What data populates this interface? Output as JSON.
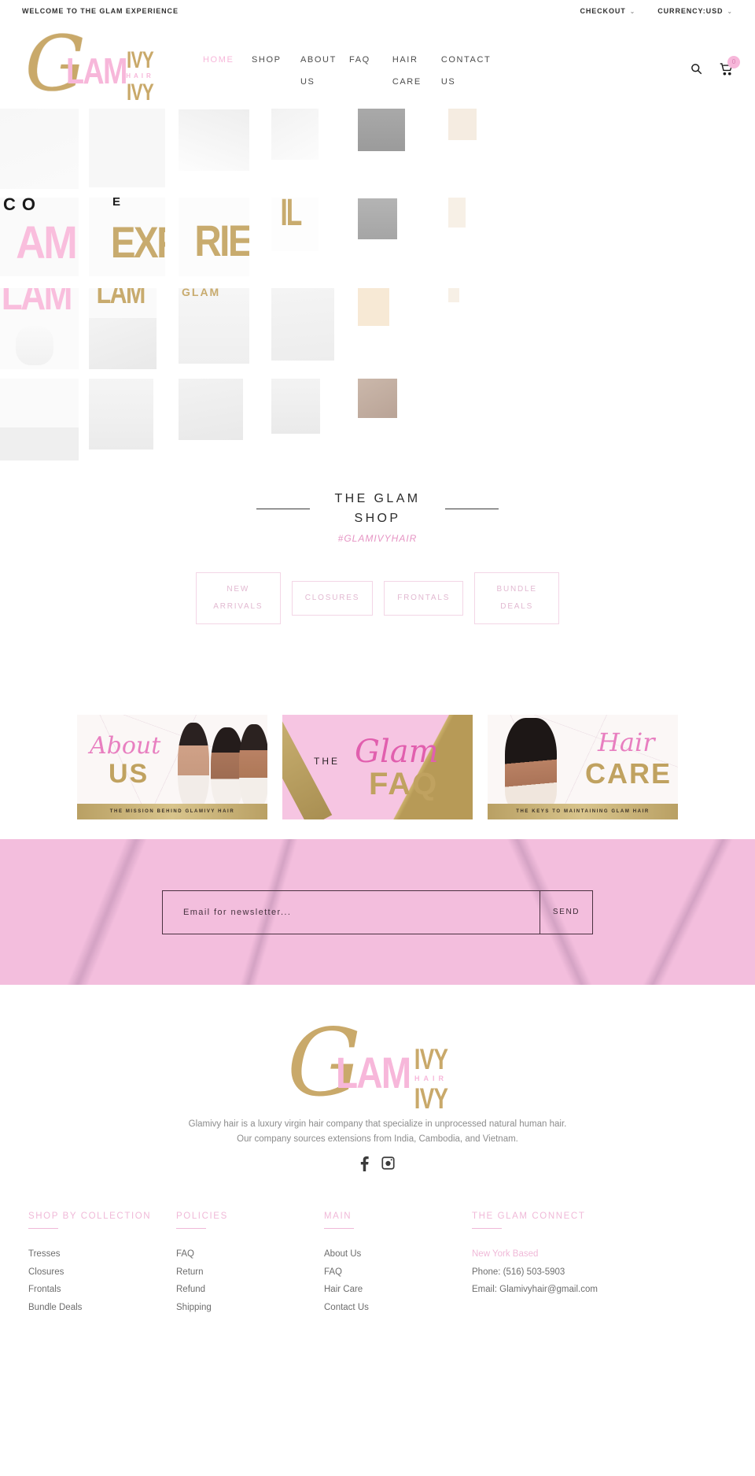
{
  "topbar": {
    "welcome": "WELCOME TO THE GLAM EXPERIENCE",
    "checkout": "CHECKOUT",
    "currency": "CURRENCY:USD",
    "caret": "⌄"
  },
  "logo": {
    "g": "G",
    "lam": "LAM",
    "ivy_top": "IVY",
    "ivy_hair": "HAIR",
    "ivy_bot": "IVY"
  },
  "nav": {
    "items": [
      {
        "label": "HOME",
        "active": true
      },
      {
        "label": "SHOP",
        "active": false
      },
      {
        "label": "ABOUT US",
        "active": false
      },
      {
        "label": "FAQ",
        "active": false
      },
      {
        "label": "HAIR CARE",
        "active": false
      },
      {
        "label": "CONTACT US",
        "active": false
      }
    ]
  },
  "header_icons": {
    "search": "search-icon",
    "cart": "cart-icon",
    "cart_count": "0"
  },
  "shop": {
    "title": "THE GLAM SHOP",
    "hashtag": "#GLAMIVYHAIR",
    "categories": [
      {
        "label": "NEW ARRIVALS"
      },
      {
        "label": "CLOSURES"
      },
      {
        "label": "FRONTALS"
      },
      {
        "label": "BUNDLE DEALS"
      }
    ]
  },
  "promos": [
    {
      "script": "About",
      "gold": "US",
      "caption": "THE MISSION BEHIND GLAMIVY HAIR"
    },
    {
      "the": "THE",
      "script": "Glam",
      "gold": "FAQ",
      "caption": ""
    },
    {
      "script": "Hair",
      "gold": "CARE",
      "caption": "THE KEYS TO MAINTAINING GLAM HAIR"
    }
  ],
  "newsletter": {
    "placeholder": "Email for newsletter...",
    "value": "",
    "send_label": "SEND"
  },
  "footer": {
    "description_line1": "Glamivy hair is a luxury virgin hair company that specialize in unprocessed natural human hair.",
    "description_line2": "Our company sources extensions from India, Cambodia, and Vietnam.",
    "socials": [
      {
        "name": "facebook-icon"
      },
      {
        "name": "instagram-icon"
      }
    ],
    "columns": [
      {
        "title": "SHOP BY COLLECTION",
        "links": [
          "Tresses",
          "Closures",
          "Frontals",
          "Bundle Deals"
        ]
      },
      {
        "title": "POLICIES",
        "links": [
          "FAQ",
          "Return",
          "Refund",
          "Shipping"
        ]
      },
      {
        "title": "MAIN",
        "links": [
          "About Us",
          "FAQ",
          "Hair Care",
          "Contact Us"
        ]
      },
      {
        "title": "THE GLAM CONNECT",
        "location": "New York Based",
        "phone": "Phone: (516) 503-5903",
        "email": "Email: Glamivyhair@gmail.com"
      }
    ]
  },
  "colors": {
    "pink": "#f7b7da",
    "pink_soft": "#f3bedd",
    "gold": "#c9a96a",
    "text": "#4b4b4b"
  }
}
